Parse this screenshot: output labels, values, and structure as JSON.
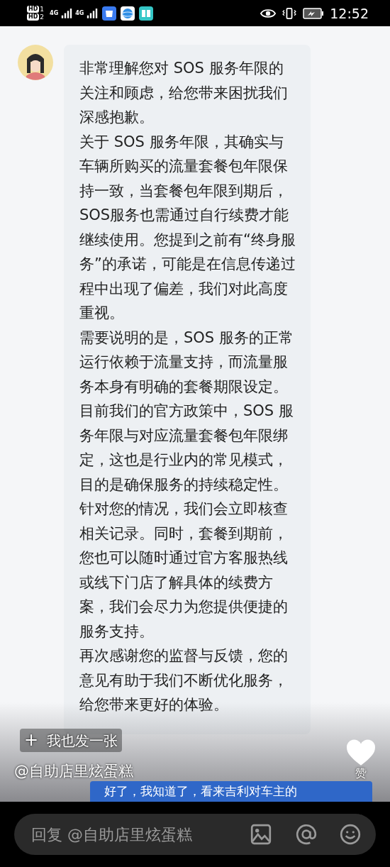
{
  "status_bar": {
    "sims": [
      {
        "hd": "HD",
        "slot": "1",
        "network": "4G"
      },
      {
        "hd": "HD",
        "slot": "2",
        "network": "4G"
      }
    ],
    "time": "12:52"
  },
  "message": {
    "paragraphs": [
      "非常理解您对 SOS 服务年限的关注和顾虑，给您带来困扰我们深感抱歉。",
      "关于 SOS 服务年限，其确实与车辆所购买的流量套餐包年限保持一致，当套餐包年限到期后，SOS服务也需通过自行续费才能继续使用。您提到之前有“终身服务”的承诺，可能是在信息传递过程中出现了偏差，我们对此高度重视。",
      "需要说明的是，SOS 服务的正常运行依赖于流量支持，而流量服务本身有明确的套餐期限设定。目前我们的官方政策中，SOS 服务年限与对应流量套餐包年限绑定，这也是行业内的常见模式，目的是确保服务的持续稳定性。",
      "针对您的情况，我们会立即核查相关记录。同时，套餐到期前，您也可以随时通过官方客服热线或线下门店了解具体的续费方案，我们会尽力为您提供便捷的服务支持。",
      "再次感谢您的监督与反馈，您的意见有助于我们不断优化服务，给您带来更好的体验。"
    ]
  },
  "post_button": {
    "icon": "+",
    "label": "我也发一张"
  },
  "author": "@自助店里炫蛋糕",
  "like": {
    "label": "赞",
    "liked": false
  },
  "comment": "好了，我知道了，看来吉利对车主的",
  "reply_field": {
    "placeholder": "回复 @自助店里炫蛋糕"
  }
}
